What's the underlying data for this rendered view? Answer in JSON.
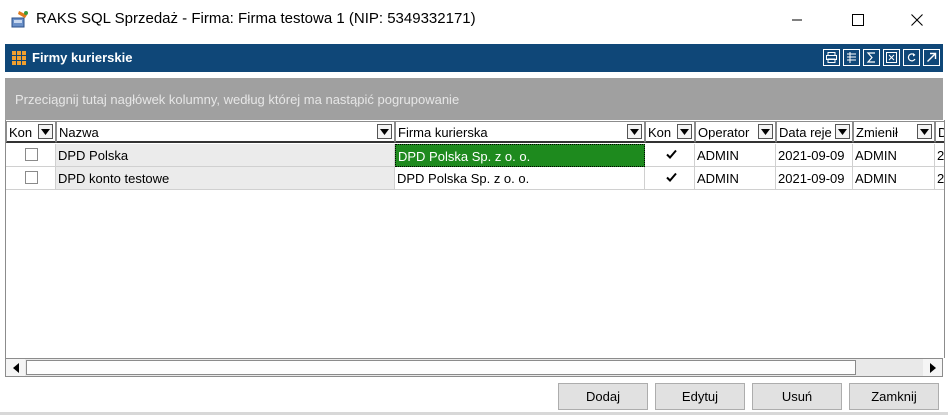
{
  "window": {
    "title": "RAKS SQL Sprzedaż - Firma: Firma testowa 1  (NIP: 5349332171)",
    "minimize_icon": "minimize-icon",
    "maximize_icon": "maximize-icon",
    "close_icon": "close-icon"
  },
  "panel": {
    "title": "Firmy kurierskie",
    "tools": [
      "print-icon",
      "column-chooser-icon",
      "sum-icon",
      "export-icon",
      "refresh-icon",
      "open-external-icon"
    ]
  },
  "group_panel": {
    "hint": "Przeciągnij tutaj nagłówek kolumny, według której ma nastąpić pogrupowanie"
  },
  "grid": {
    "columns": [
      "Kon",
      "Nazwa",
      "Firma kurierska",
      "Kon",
      "Operator",
      "Data reje",
      "Zmienił",
      "D"
    ],
    "rows": [
      {
        "kon": false,
        "nazwa": "DPD Polska",
        "firma": "DPD Polska Sp. z o. o.",
        "kon2": true,
        "operator": "ADMIN",
        "data": "2021-09-09",
        "zmienil": "ADMIN",
        "d": "2"
      },
      {
        "kon": false,
        "nazwa": "DPD konto testowe",
        "firma": "DPD Polska Sp. z o. o.",
        "kon2": true,
        "operator": "ADMIN",
        "data": "2021-09-09",
        "zmienil": "ADMIN",
        "d": "2"
      }
    ],
    "selected_color": "#1e8a1e"
  },
  "buttons": {
    "add": "Dodaj",
    "edit": "Edytuj",
    "delete": "Usuń",
    "close": "Zamknij"
  },
  "colors": {
    "panel_header": "#0f4778",
    "group_panel": "#a0a0a0"
  }
}
